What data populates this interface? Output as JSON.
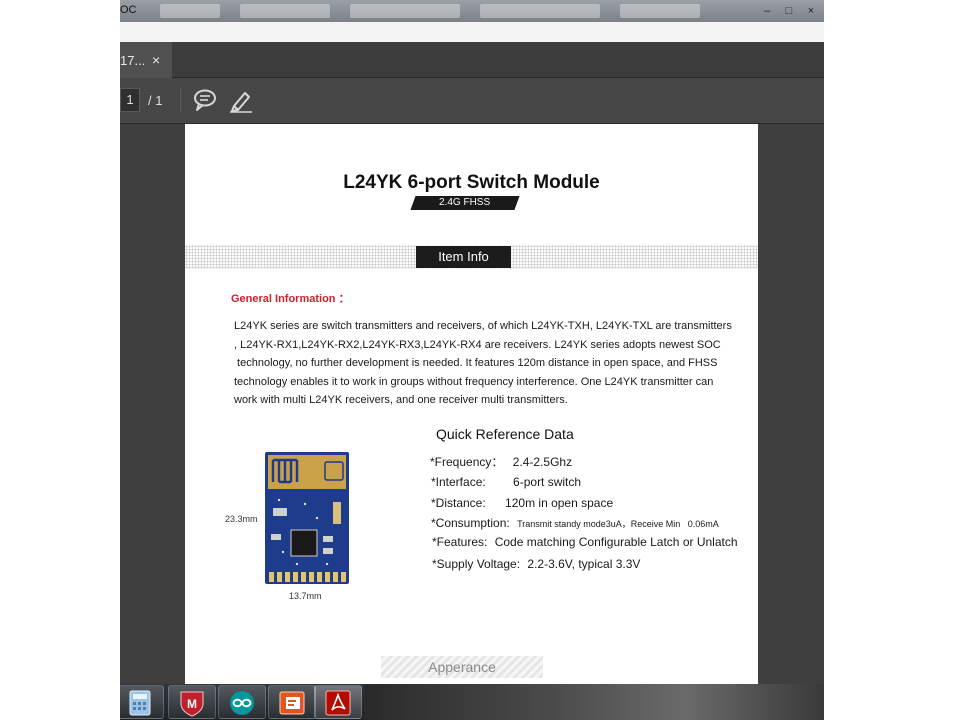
{
  "window": {
    "title_fragment": "OC"
  },
  "tabs": [
    {
      "label": "17...",
      "close": "×"
    }
  ],
  "toolbar": {
    "page_current": "1",
    "page_total": "/ 1"
  },
  "document": {
    "title": "L24YK 6-port Switch Module",
    "subtitle": "2.4G FHSS",
    "section_label": "Item Info",
    "general": {
      "heading": "General Information ：",
      "lines": [
        "L24YK series are switch transmitters and receivers, of which L24YK-TXH, L24YK-TXL are transmitters",
        ", L24YK-RX1,L24YK-RX2,L24YK-RX3,L24YK-RX4 are receivers. L24YK series adopts newest SOC",
        " technology, no further development is needed. It features 120m distance in open space, and FHSS",
        "technology enables it to work in groups without frequency interference. One L24YK transmitter can",
        "work with multi L24YK receivers, and one receiver multi transmitters."
      ]
    },
    "quick_ref": {
      "heading": "Quick Reference Data",
      "items": [
        {
          "label": "*Frequency：",
          "value": "2.4-2.5Ghz"
        },
        {
          "label": "*Interface:",
          "value": "6-port switch"
        },
        {
          "label": "*Distance:",
          "value": "120m in open space"
        },
        {
          "label": "*Consumption:",
          "value": "Transmit standy mode3uA，Receive Min   0.06mA"
        },
        {
          "label": "*Features:",
          "value": "Code matching Configurable Latch or Unlatch"
        },
        {
          "label": "*Supply Voltage:",
          "value": "2.2-3.6V, typical 3.3V"
        }
      ]
    },
    "module_dims": {
      "height": "23.3mm",
      "width": "13.7mm"
    },
    "appearance_label": "Apperance"
  },
  "taskbar": {
    "apps": [
      {
        "name": "calculator-icon"
      },
      {
        "name": "mcafee-icon"
      },
      {
        "name": "arduino-icon"
      },
      {
        "name": "presentation-icon"
      },
      {
        "name": "acrobat-icon"
      }
    ]
  },
  "colors": {
    "accent_red": "#d11f2a",
    "toolbar": "#474747",
    "canvas": "#3f3f3f"
  }
}
